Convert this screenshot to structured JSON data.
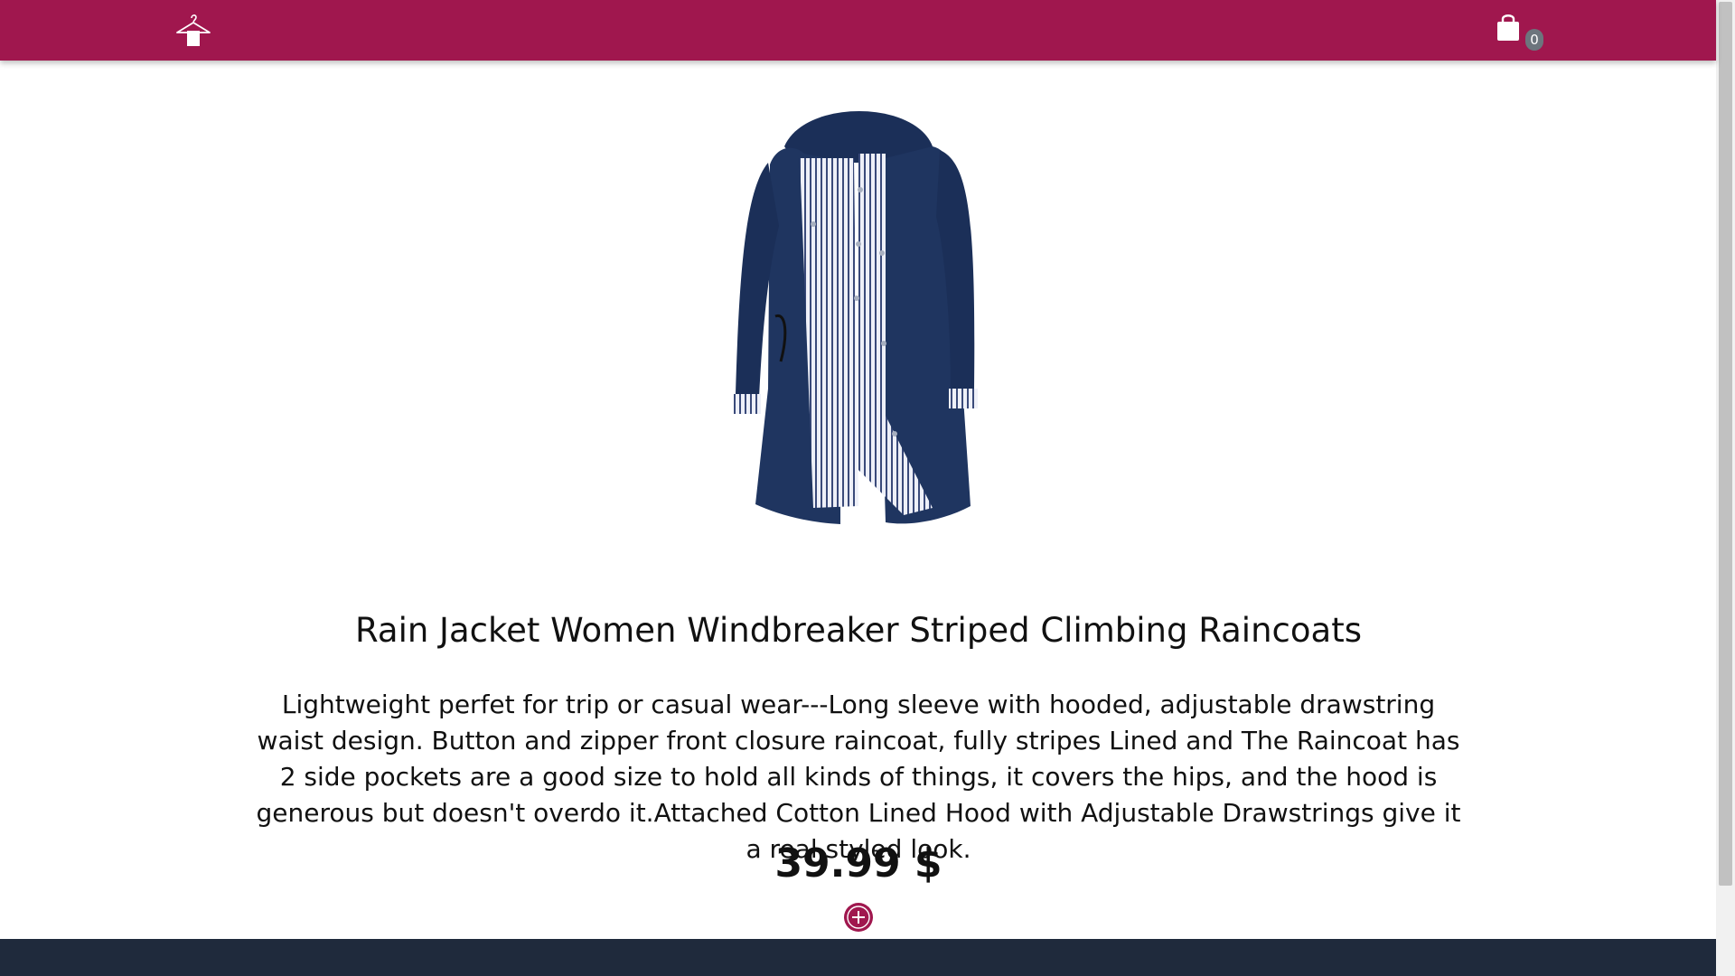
{
  "header": {
    "brand_icon": "hanger-icon",
    "cart_icon": "shopping-bag-icon",
    "cart_count": "0",
    "bar_color": "#a0174e"
  },
  "product": {
    "image": "navy-rain-jacket-striped-lining",
    "title": "Rain Jacket Women Windbreaker Striped Climbing Raincoats",
    "description": "Lightweight perfet for trip or casual wear---Long sleeve with hooded, adjustable drawstring waist design. Button and zipper front closure raincoat, fully stripes Lined and The Raincoat has 2 side pockets are a good size to hold all kinds of things, it covers the hips, and the hood is generous but doesn't overdo it.Attached Cotton Lined Hood with Adjustable Drawstrings give it a real styled look.",
    "price": "39.99 $",
    "add_icon": "plus-circle-icon"
  },
  "colors": {
    "accent": "#a0174e",
    "footer": "#1f2a3c",
    "jacket": "#1f3560"
  }
}
